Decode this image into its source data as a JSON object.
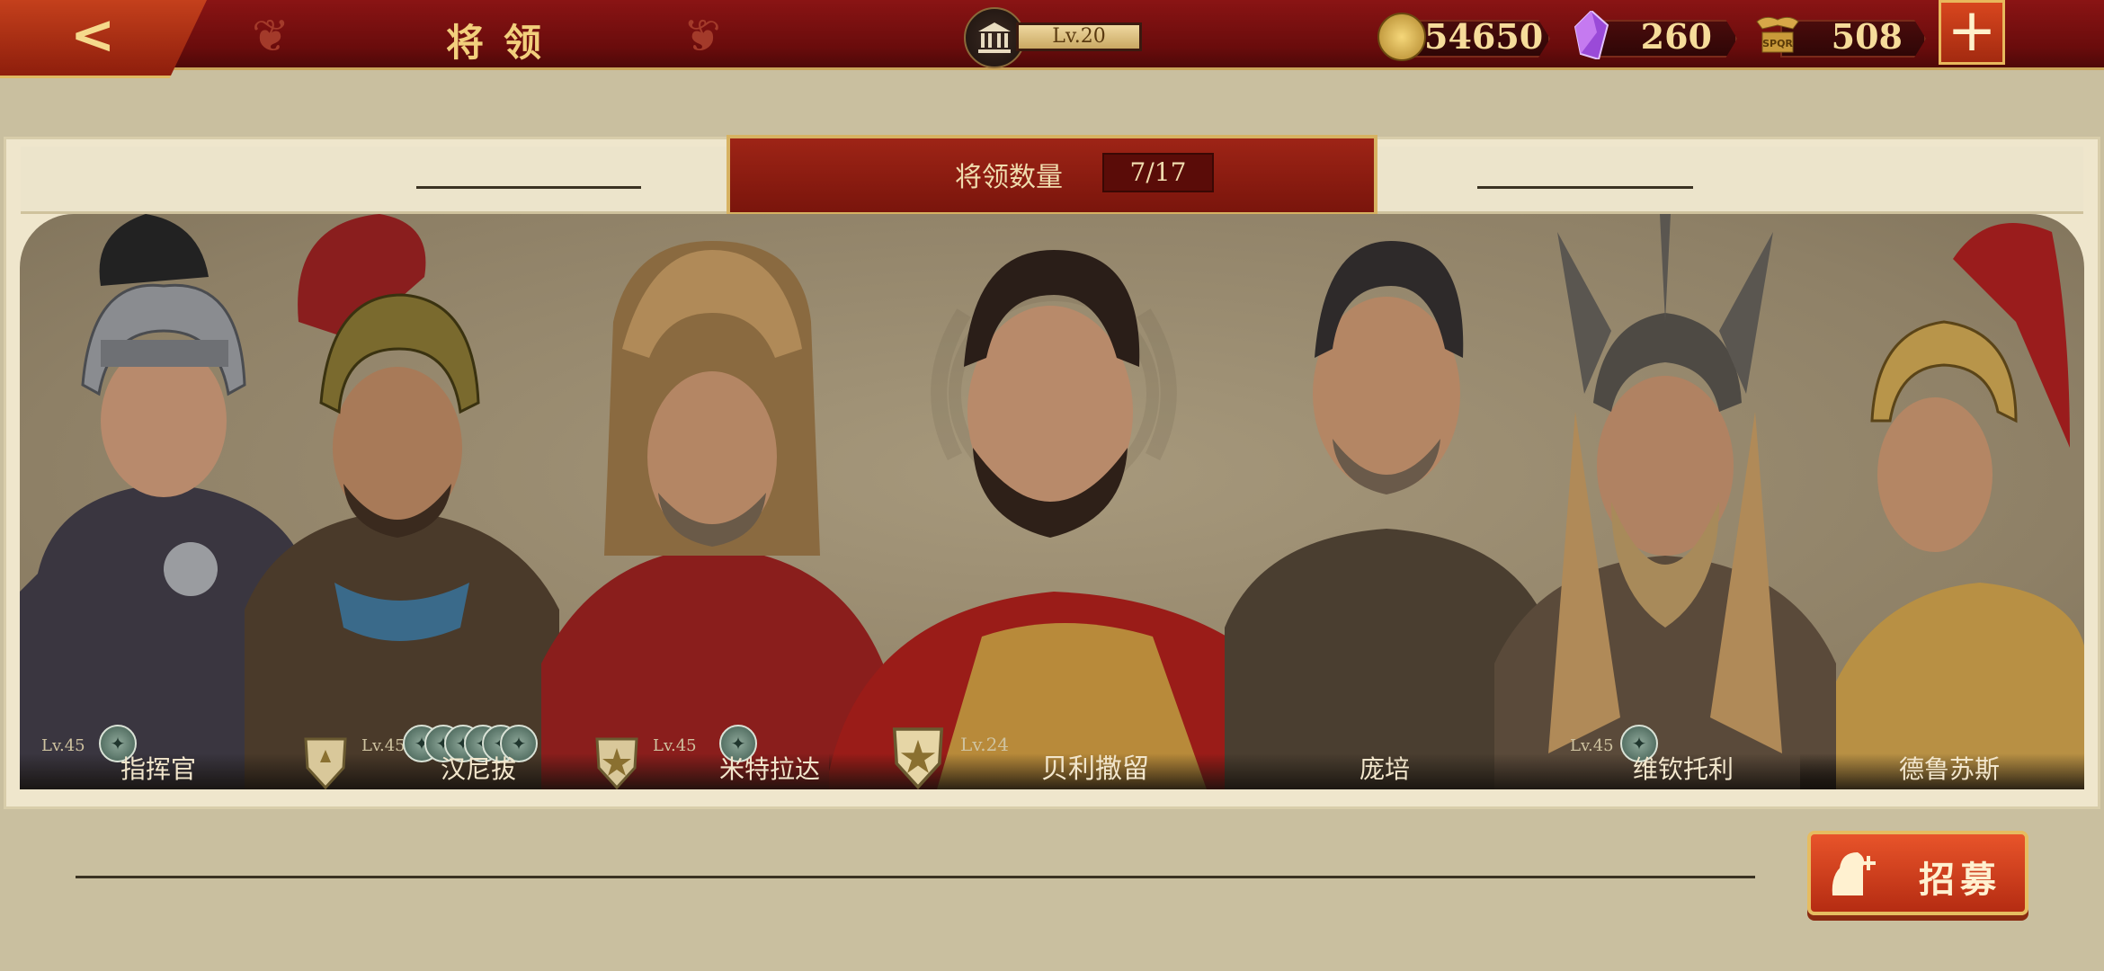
{
  "header": {
    "title": "将领",
    "building_level": "Lv.20",
    "gold": "54650",
    "gems": "260",
    "honor": "508",
    "honor_badge_text": "SPQR",
    "add_label": "+",
    "back_label": "<"
  },
  "panel": {
    "count_label": "将领数量",
    "count_value": "7/17"
  },
  "heroes": [
    {
      "name": "指挥官",
      "level": "Lv.45",
      "skills": 1
    },
    {
      "name": "汉尼拔",
      "level": "Lv.45",
      "skills": 6
    },
    {
      "name": "米特拉达",
      "level": "Lv.45",
      "skills": 1
    },
    {
      "name": "贝利撒留",
      "level": "Lv.24",
      "skills": 0
    },
    {
      "name": "庞培",
      "level": "",
      "skills": 0
    },
    {
      "name": "维钦托利",
      "level": "Lv.45",
      "skills": 1
    },
    {
      "name": "德鲁苏斯",
      "level": "",
      "skills": 0
    }
  ],
  "recruit": {
    "label": "招募"
  },
  "colors": {
    "accent_red": "#8a1414",
    "gold": "#f2cf7c",
    "panel": "#efe6cc",
    "button": "#d8461e"
  }
}
